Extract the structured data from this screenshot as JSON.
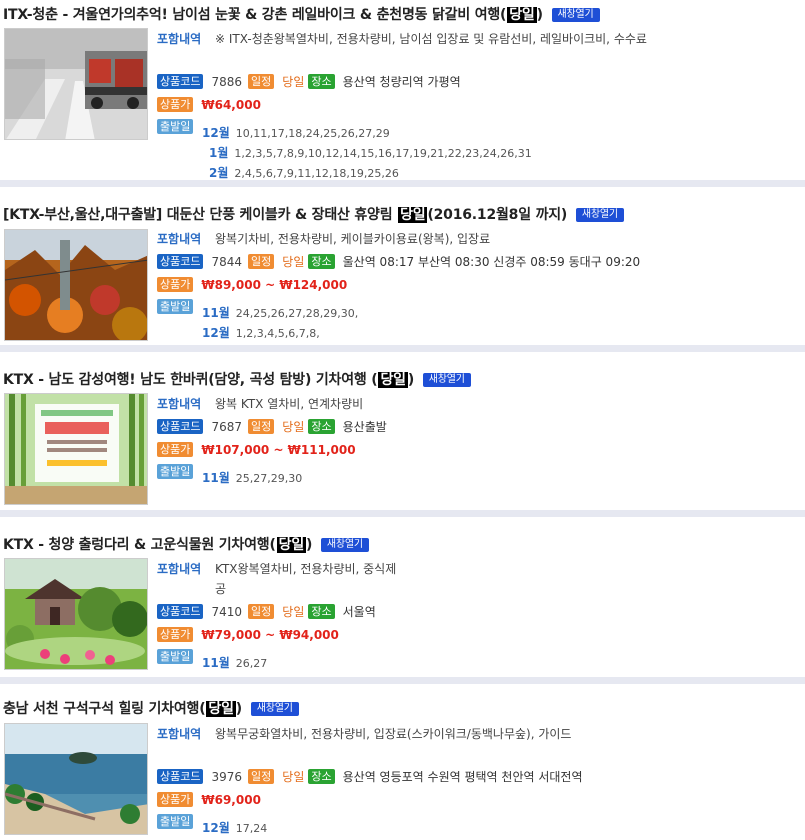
{
  "labels": {
    "includes": "포함내역",
    "code": "상품코드",
    "duration": "일정",
    "location": "장소",
    "price": "상품가",
    "departure": "출발일",
    "new_window": "새창열기"
  },
  "colors": {
    "link_blue": "#2b6cc4",
    "price_red": "#e2231a",
    "duration_orange": "#e36c1a",
    "separator": "#e6e8f1",
    "new_window_btn": "#1e4fd6"
  },
  "products": [
    {
      "title_main": "ITX-청춘 - 겨울연가의추억! 남이섬 눈꽃 & 강촌 레일바이크 & 춘천명동 닭갈비 여행(",
      "title_day": "당일",
      "title_tail": ")",
      "image_icon": "snowy-train-photo",
      "includes": "※ ITX-청춘왕복열차비, 전용차량비, 남이섬 입장료 및 유람선비, 레일바이크비, 수수료",
      "code": "7886",
      "duration": "당일",
      "location": "용산역 청량리역 가평역",
      "price": "₩64,000",
      "departures": [
        {
          "month": "12월",
          "days": "10,11,17,18,24,25,26,27,29"
        },
        {
          "month": "1월",
          "days": "1,2,3,5,7,8,9,10,12,14,15,16,17,19,21,22,23,24,26,31"
        },
        {
          "month": "2월",
          "days": "2,4,5,6,7,9,11,12,18,19,25,26"
        }
      ]
    },
    {
      "title_main": "[KTX-부산,울산,대구출발] 대둔산 단풍 케이블카 & 장태산 휴양림 ",
      "title_day": "당일",
      "title_tail": "(2016.12월8일 까지)",
      "image_icon": "autumn-mountain-photo",
      "includes": "왕복기차비, 전용차량비, 케이블카이용료(왕복), 입장료",
      "code": "7844",
      "duration": "당일",
      "location": "울산역 08:17 부산역 08:30 신경주 08:59 동대구 09:20",
      "price": "₩89,000 ~ ₩124,000",
      "departures": [
        {
          "month": "11월",
          "days": "24,25,26,27,28,29,30,"
        },
        {
          "month": "12월",
          "days": "1,2,3,4,5,6,7,8,"
        }
      ]
    },
    {
      "title_main": "KTX - 남도 감성여행! 남도 한바퀴(담양, 곡성 탐방) 기차여행 (",
      "title_day": "당일",
      "title_tail": ")",
      "image_icon": "bamboo-forest-photo",
      "includes": "왕복 KTX 열차비, 연계차량비",
      "code": "7687",
      "duration": "당일",
      "location": "용산출발",
      "price": "₩107,000 ~ ₩111,000",
      "departures": [
        {
          "month": "11월",
          "days": "25,27,29,30"
        }
      ]
    },
    {
      "title_main": "KTX - 청양 출렁다리 & 고운식물원 기차여행(",
      "title_day": "당일",
      "title_tail": ")",
      "image_icon": "botanical-garden-photo",
      "includes": "KTX왕복열차비, 전용차량비, 중식제공",
      "code": "7410",
      "duration": "당일",
      "location": "서울역",
      "price": "₩79,000 ~ ₩94,000",
      "departures": [
        {
          "month": "11월",
          "days": "26,27"
        }
      ]
    },
    {
      "title_main": "충남 서천 구석구석 힐링 기차여행(",
      "title_day": "당일",
      "title_tail": ")",
      "image_icon": "seaside-island-photo",
      "includes": "왕복무궁화열차비, 전용차량비, 입장료(스카이워크/동백나무숲), 가이드",
      "code": "3976",
      "duration": "당일",
      "location": "용산역 영등포역 수원역 평택역 천안역 서대전역",
      "price": "₩69,000",
      "departures": [
        {
          "month": "12월",
          "days": "17,24"
        }
      ]
    }
  ]
}
